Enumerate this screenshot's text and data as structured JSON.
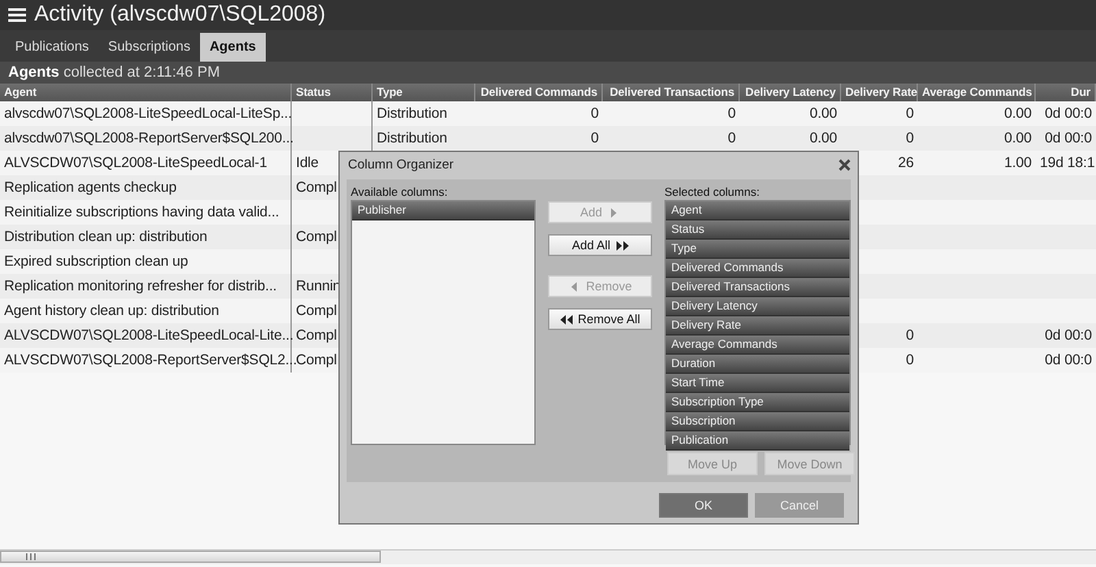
{
  "window": {
    "title": "Activity (alvscdw07\\SQL2008)"
  },
  "tabs": [
    {
      "label": "Publications",
      "selected": false
    },
    {
      "label": "Subscriptions",
      "selected": false
    },
    {
      "label": "Agents",
      "selected": true
    }
  ],
  "info_bar": "**Agents** collected at 2:11:46 PM",
  "table": {
    "columns": [
      "Agent",
      "Status",
      "Type",
      "Delivered Commands",
      "Delivered Transactions",
      "Delivery Latency",
      "Delivery Rate",
      "Average Commands",
      "Dur"
    ],
    "rows": [
      [
        "alvscdw07\\SQL2008-LiteSpeedLocal-LiteSp...",
        null,
        "Distribution",
        "0",
        "0",
        "0.00",
        "0",
        "0.00",
        "0d 00:0"
      ],
      [
        "alvscdw07\\SQL2008-ReportServer$SQL200...",
        null,
        "Distribution",
        "0",
        "0",
        "0.00",
        "0",
        "0.00",
        "0d 00:0"
      ],
      [
        "ALVSCDW07\\SQL2008-LiteSpeedLocal-1",
        "Idle",
        null,
        null,
        null,
        null,
        "26",
        "1.00",
        "19d 18:1"
      ],
      [
        "Replication agents checkup",
        "Compl",
        null,
        null,
        null,
        null,
        null,
        null,
        null
      ],
      [
        "Reinitialize subscriptions having data valid...",
        null,
        null,
        null,
        null,
        null,
        null,
        null,
        null
      ],
      [
        "Distribution clean up: distribution",
        "Compl",
        null,
        null,
        null,
        null,
        null,
        null,
        null
      ],
      [
        "Expired subscription clean up",
        null,
        null,
        null,
        null,
        null,
        null,
        null,
        null
      ],
      [
        "Replication monitoring refresher for distrib...",
        "Runnin",
        null,
        null,
        null,
        null,
        null,
        null,
        null
      ],
      [
        "Agent history clean up: distribution",
        "Compl",
        null,
        null,
        null,
        null,
        null,
        null,
        null
      ],
      [
        "ALVSCDW07\\SQL2008-LiteSpeedLocal-Lite...",
        "Compl",
        null,
        null,
        null,
        null,
        "0",
        null,
        "0d 00:0"
      ],
      [
        "ALVSCDW07\\SQL2008-ReportServer$SQL2...",
        "Compl",
        null,
        null,
        null,
        null,
        "0",
        null,
        "0d 00:0"
      ]
    ]
  },
  "dialog": {
    "title": "Column Organizer",
    "available": {
      "label": "Available columns:",
      "items": [
        {
          "label": "Publisher",
          "selected": true
        }
      ]
    },
    "transfer_buttons": [
      {
        "label": "Add",
        "disabled": true
      },
      {
        "label": "Add All",
        "disabled": false
      },
      {
        "label": "Remove",
        "disabled": true
      },
      {
        "label": "Remove All",
        "disabled": false
      }
    ],
    "selected": {
      "label": "Selected columns:",
      "items": [
        {
          "label": "Agent",
          "selected": true
        },
        {
          "label": "Status",
          "selected": true
        },
        {
          "label": "Type",
          "selected": true
        },
        {
          "label": "Delivered Commands",
          "selected": true
        },
        {
          "label": "Delivered Transactions",
          "selected": true
        },
        {
          "label": "Delivery Latency",
          "selected": true
        },
        {
          "label": "Delivery Rate",
          "selected": true
        },
        {
          "label": "Average Commands",
          "selected": true
        },
        {
          "label": "Duration",
          "selected": true
        },
        {
          "label": "Start Time",
          "selected": true
        },
        {
          "label": "Subscription Type",
          "selected": true
        },
        {
          "label": "Subscription",
          "selected": true
        },
        {
          "label": "Publication",
          "selected": true
        }
      ]
    },
    "move_buttons": [
      {
        "label": "Move Up",
        "disabled": true
      },
      {
        "label": "Move Down",
        "disabled": true
      }
    ],
    "buttons": [
      {
        "label": "OK",
        "kind": "default"
      },
      {
        "label": "Cancel",
        "kind": "normal"
      }
    ]
  }
}
